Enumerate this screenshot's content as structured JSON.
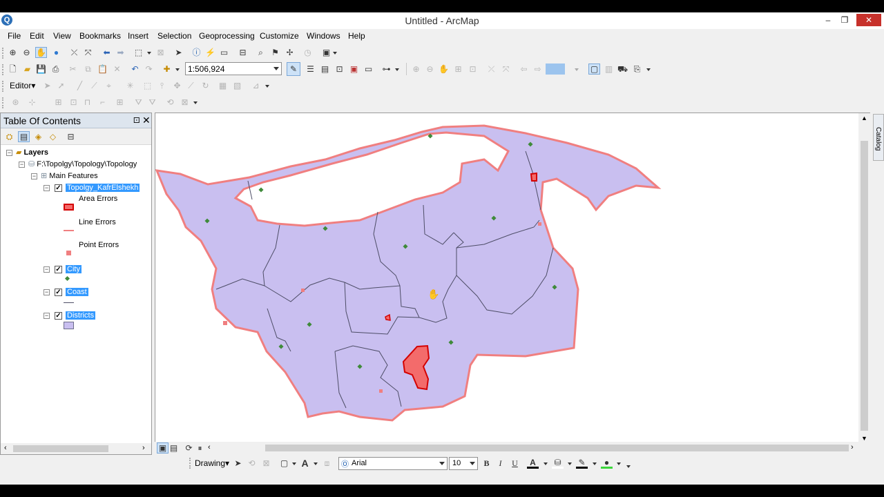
{
  "window": {
    "title": "Untitled - ArcMap",
    "logo": "Q",
    "minimize": "–",
    "restore": "❐",
    "close": "✕"
  },
  "menu": [
    "File",
    "Edit",
    "View",
    "Bookmarks",
    "Insert",
    "Selection",
    "Geoprocessing",
    "Customize",
    "Windows",
    "Help"
  ],
  "toolbar": {
    "scale": "1:506,924",
    "editor_label": "Editor▾"
  },
  "toc": {
    "title": "Table Of Contents",
    "pin": "⚀",
    "close": "✕",
    "layers_label": "Layers",
    "workspace_path": "F:\\Topolgy\\Topology\\Topology",
    "group_label": "Main Features",
    "topology_layer": "Topolgy_KafrElshekh",
    "area_errors": "Area Errors",
    "line_errors": "Line Errors",
    "point_errors": "Point Errors",
    "city_layer": "City",
    "coast_layer": "Coast",
    "districts_layer": "Districts"
  },
  "catalog_tab": "Catalog",
  "drawing": {
    "drawing_label": "Drawing▾",
    "font_name": "Arial",
    "font_size": "10",
    "bold": "B",
    "italic": "I",
    "underline": "U",
    "text_tool": "A"
  },
  "colors": {
    "district_fill": "#c9bff0",
    "district_edge": "#4d4d66",
    "boundary_error": "#f07f80",
    "area_error_fill": "#f36b6b",
    "area_error_edge": "#d40000",
    "city_point": "#3f8a3a",
    "selected": "#3399ff"
  }
}
